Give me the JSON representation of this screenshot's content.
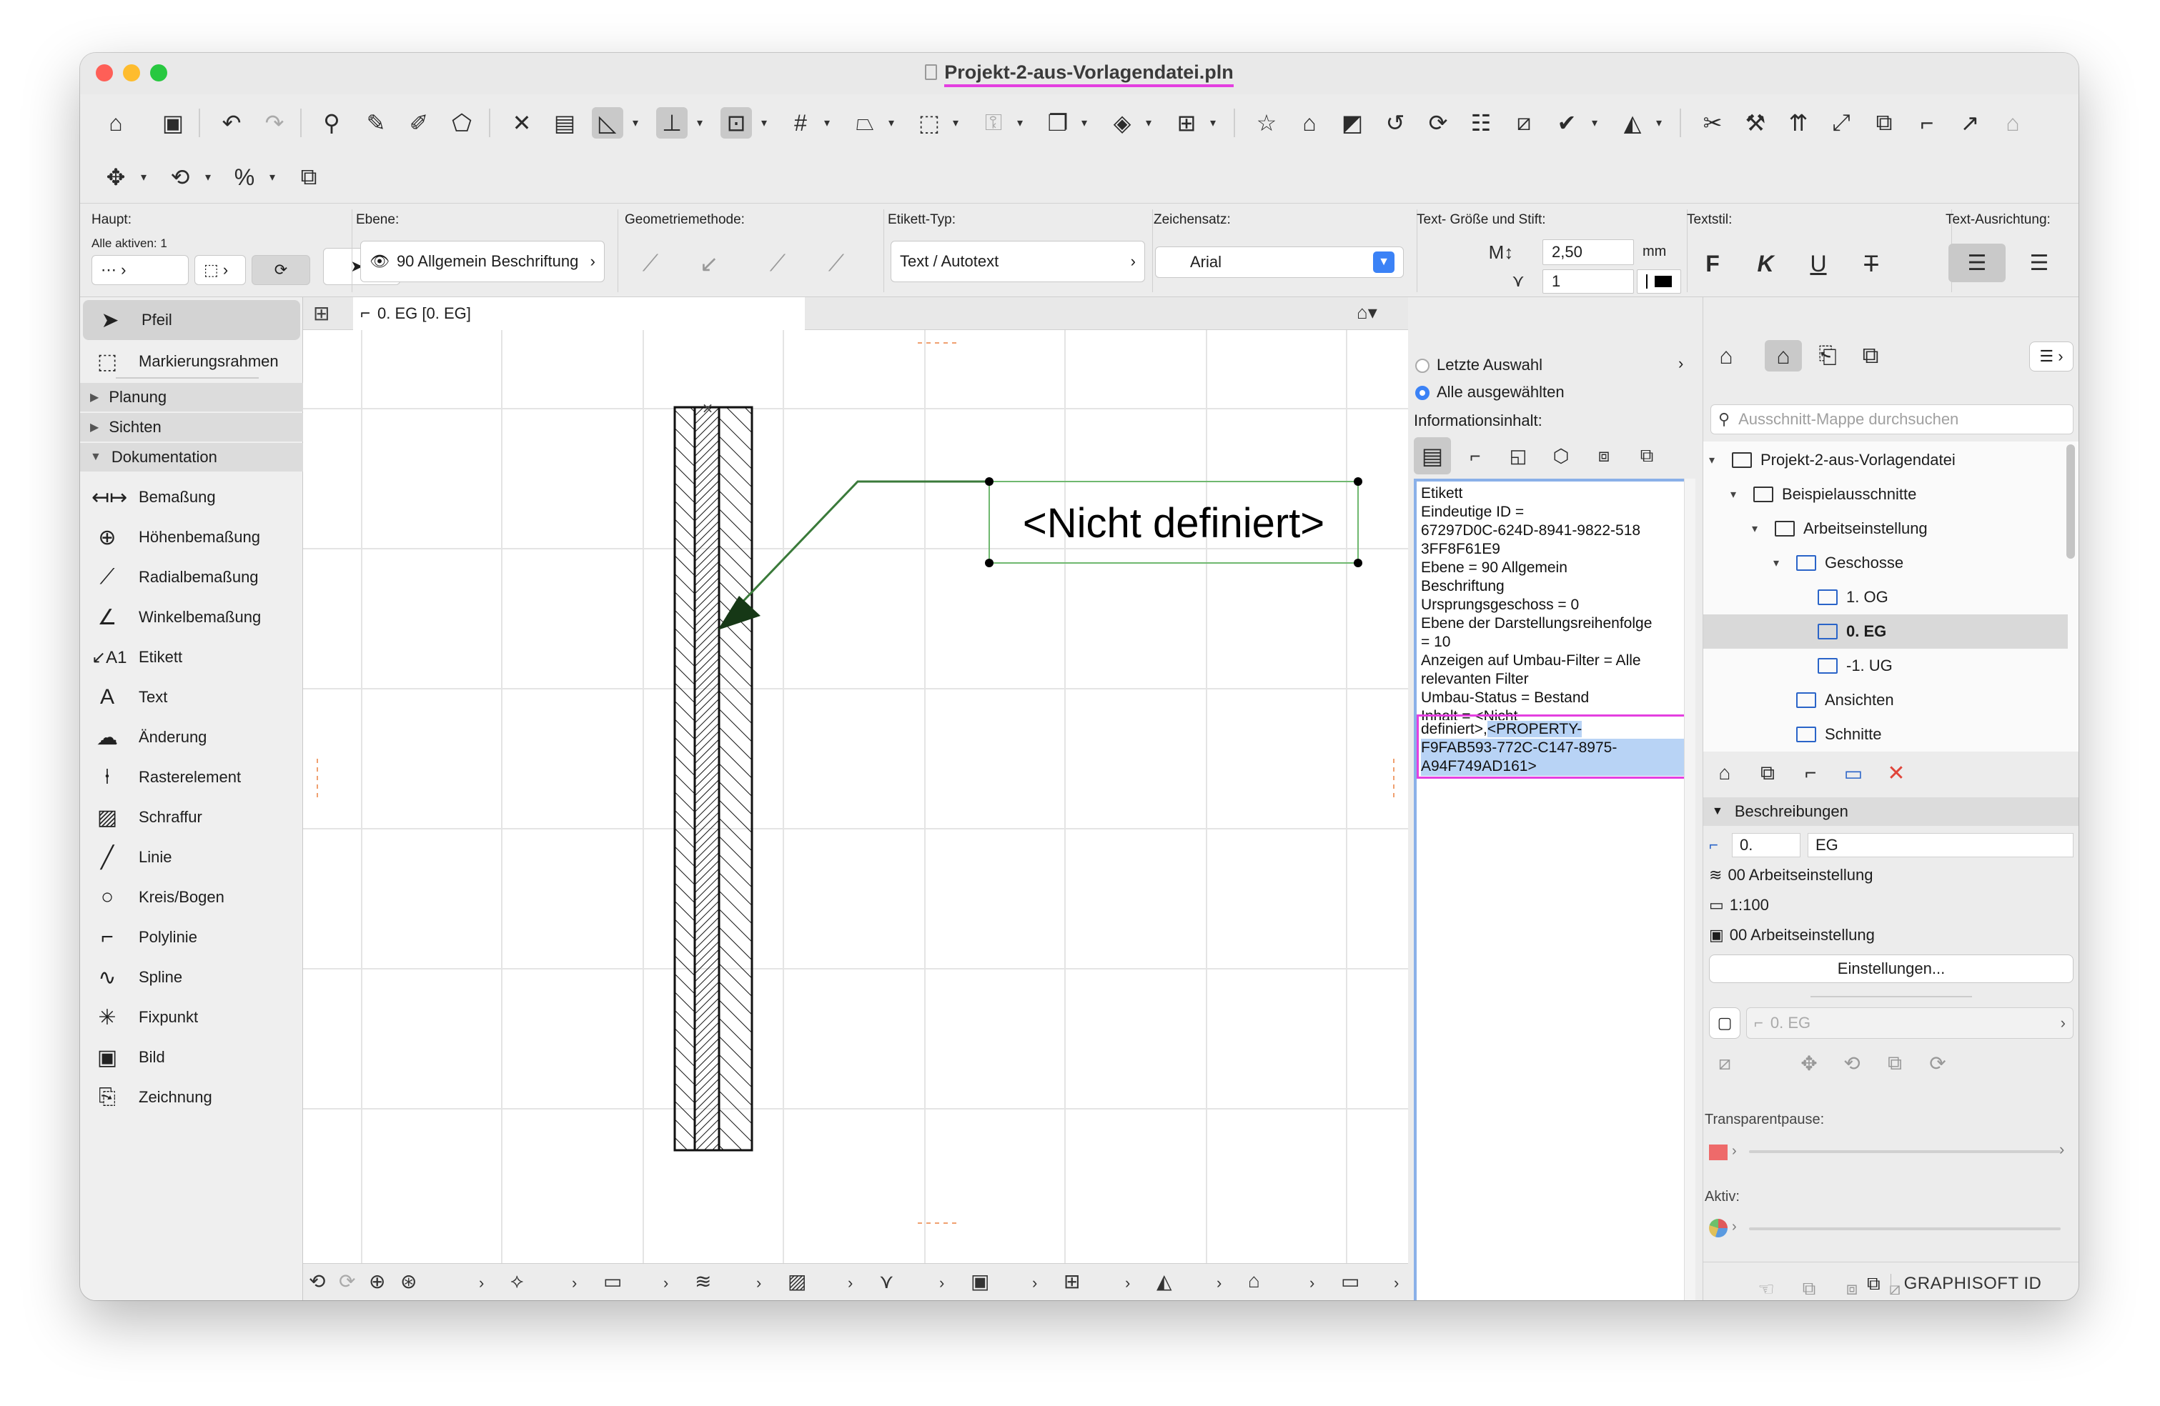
{
  "window": {
    "title": "Projekt-2-aus-Vorlagendatei.pln"
  },
  "infobox": {
    "haupt_label": "Haupt:",
    "alle_aktiven": "Alle aktiven: 1",
    "ebene_label": "Ebene:",
    "ebene_value": "90 Allgemein Beschriftung",
    "geometrie_label": "Geometriemethode:",
    "etikett_typ_label": "Etikett-Typ:",
    "etikett_typ_value": "Text / Autotext",
    "zeichensatz_label": "Zeichensatz:",
    "zeichensatz_value": "Arial",
    "text_groesse_label": "Text- Größe und Stift:",
    "text_groesse_value": "2,50",
    "text_groesse_unit": "mm",
    "stift_value": "1",
    "textstil_label": "Textstil:",
    "textstil_bold": "F",
    "textstil_italic": "K",
    "textstil_underline": "U",
    "textstil_strike": "T",
    "text_ausrichtung_label": "Text-Ausrichtung:"
  },
  "toolbox": {
    "items_top": [
      {
        "label": "Pfeil",
        "icon": "arrow-pointer-icon"
      },
      {
        "label": "Markierungsrahmen",
        "icon": "marquee-icon"
      }
    ],
    "groups": [
      "Planung",
      "Sichten",
      "Dokumentation"
    ],
    "items_doc": [
      {
        "label": "Bemaßung",
        "icon": "dimension-icon"
      },
      {
        "label": "Höhenbemaßung",
        "icon": "level-dimension-icon"
      },
      {
        "label": "Radialbemaßung",
        "icon": "radial-dimension-icon"
      },
      {
        "label": "Winkelbemaßung",
        "icon": "angle-dimension-icon"
      },
      {
        "label": "Etikett",
        "icon": "label-icon"
      },
      {
        "label": "Text",
        "icon": "text-icon"
      },
      {
        "label": "Änderung",
        "icon": "change-icon"
      },
      {
        "label": "Rasterelement",
        "icon": "grid-element-icon"
      },
      {
        "label": "Schraffur",
        "icon": "fill-icon"
      },
      {
        "label": "Linie",
        "icon": "line-icon"
      },
      {
        "label": "Kreis/Bogen",
        "icon": "circle-icon"
      },
      {
        "label": "Polylinie",
        "icon": "polyline-icon"
      },
      {
        "label": "Spline",
        "icon": "spline-icon"
      },
      {
        "label": "Fixpunkt",
        "icon": "hotspot-icon"
      },
      {
        "label": "Bild",
        "icon": "image-icon"
      },
      {
        "label": "Zeichnung",
        "icon": "drawing-icon"
      }
    ]
  },
  "canvas": {
    "tab_label": "0. EG [0. EG]",
    "label_text": "<Nicht definiert>"
  },
  "infopanel": {
    "option_last": "Letzte Auswahl",
    "option_all": "Alle ausgewählten",
    "content_label": "Informationsinhalt:",
    "lines": [
      "Etikett",
      "Eindeutige ID =",
      "67297D0C-624D-8941-9822-518",
      "3FF8F61E9",
      "Ebene = 90 Allgemein",
      "Beschriftung",
      "Ursprungsgeschoss = 0",
      "Ebene der Darstellungsreihenfolge",
      "= 10",
      "Anzeigen auf Umbau-Filter = Alle",
      "relevanten Filter",
      "Umbau-Status = Bestand",
      "Inhalt = <Nicht"
    ],
    "line_partial": "definiert>,",
    "highlighted": [
      "<PROPERTY-",
      "F9FAB593-772C-C147-8975-",
      "A94F749AD161>"
    ]
  },
  "navigator": {
    "search_placeholder": "Ausschnitt-Mappe durchsuchen",
    "tree": [
      {
        "label": "Projekt-2-aus-Vorlagendatei",
        "level": 0,
        "fold": "▾"
      },
      {
        "label": "Beispielausschnitte",
        "level": 1,
        "fold": "▾"
      },
      {
        "label": "Arbeitseinstellung",
        "level": 2,
        "fold": "▾"
      },
      {
        "label": "Geschosse",
        "level": 3,
        "fold": "▾"
      },
      {
        "label": "1. OG",
        "level": 4,
        "fold": ""
      },
      {
        "label": "0. EG",
        "level": 4,
        "fold": ""
      },
      {
        "label": "-1. UG",
        "level": 4,
        "fold": ""
      },
      {
        "label": "Ansichten",
        "level": 3,
        "fold": ""
      },
      {
        "label": "Schnitte",
        "level": 3,
        "fold": ""
      }
    ],
    "descriptions_title": "Beschreibungen",
    "desc_id": "0.",
    "desc_name": "EG",
    "desc_layer": "00 Arbeitseinstellung",
    "desc_scale": "1:100",
    "desc_pen": "00 Arbeitseinstellung",
    "settings_button": "Einstellungen...",
    "story_field": "0. EG",
    "transparent_label": "Transparentpause:",
    "aktiv_label": "Aktiv:",
    "graphisoft": "GRAPHISOFT ID"
  },
  "colors": {
    "accent_blue": "#3b82f6",
    "highlight_magenta": "#e43fe0",
    "selection_blue": "#b8d3f5",
    "delete_red": "#e0453a"
  }
}
